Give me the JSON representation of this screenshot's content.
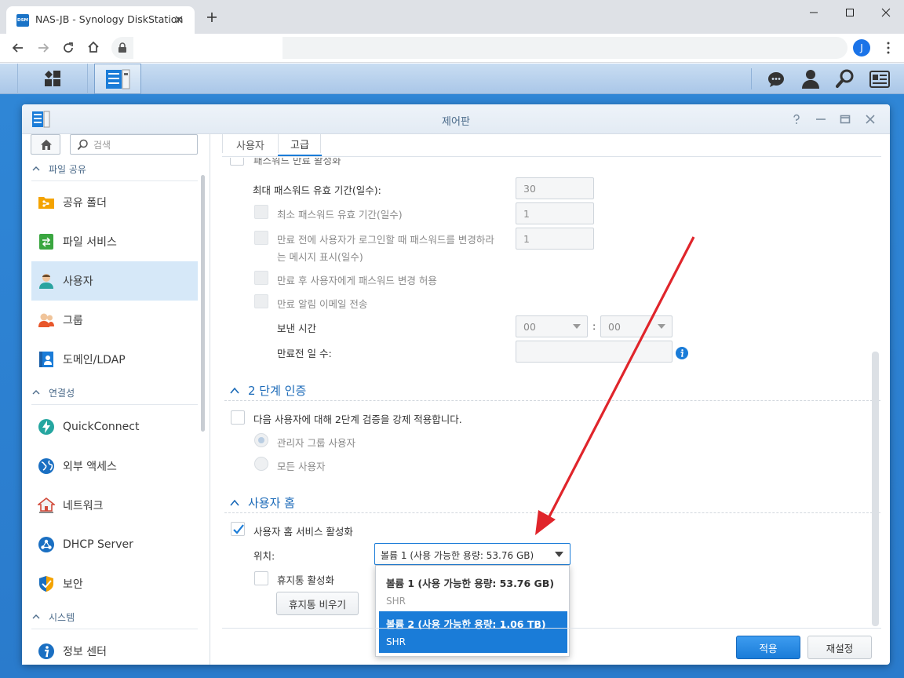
{
  "browser": {
    "tab_title": "NAS-JB - Synology DiskStation",
    "favicon_text": "DSM",
    "avatar_letter": "J"
  },
  "window": {
    "title": "제어판"
  },
  "sidebar": {
    "search_placeholder": "검색",
    "sections": {
      "file_sharing": "파일 공유",
      "connectivity": "연결성",
      "system": "시스템"
    },
    "items": {
      "shared_folder": "공유 폴더",
      "file_services": "파일 서비스",
      "user": "사용자",
      "group": "그룹",
      "domain_ldap": "도메인/LDAP",
      "quickconnect": "QuickConnect",
      "external_access": "외부 액세스",
      "network": "네트워크",
      "dhcp_server": "DHCP Server",
      "security": "보안",
      "info_center": "정보 센터"
    }
  },
  "tabs": {
    "user": "사용자",
    "advanced": "고급"
  },
  "password_expiry": {
    "partial_label": "패스워드 만료 활성화",
    "max_age_label": "최대 패스워드 유효 기간(일수):",
    "max_age_value": "30",
    "min_age_label": "최소 패스워드 유효 기간(일수)",
    "min_age_value": "1",
    "notify_label_line1": "만료 전에 사용자가 로그인할 때 패스워드를 변경하라",
    "notify_label_line2": "는 메시지 표시(일수)",
    "notify_value": "1",
    "allow_after_expiry": "만료 후 사용자에게 패스워드 변경 허용",
    "email_notify": "만료 알림 이메일 전송",
    "send_time_label": "보낸 시간",
    "hour_value": "00",
    "minute_value": "00",
    "time_sep": ":",
    "days_before_label": "만료전 일 수:"
  },
  "two_step": {
    "title": "2 단계 인증",
    "enforce_label": "다음 사용자에 대해 2단계 검증을 강제 적용합니다.",
    "admin_group": "관리자 그룹 사용자",
    "all_users": "모든 사용자"
  },
  "user_home": {
    "title": "사용자 홈",
    "enable_label": "사용자 홈 서비스 활성화",
    "location_label": "위치:",
    "location_value": "볼륨 1 (사용 가능한 용량:  53.76 GB)",
    "recycle_label": "휴지통 활성화",
    "empty_recycle_button": "휴지통 비우기",
    "options": [
      {
        "label": "볼륨 1 (사용 가능한 용량: 53.76 GB)",
        "sub": "SHR"
      },
      {
        "label": "볼륨 2 (사용 가능한 용량: 1.06 TB)",
        "sub": "SHR"
      }
    ]
  },
  "footer": {
    "apply": "적용",
    "reset": "재설정"
  },
  "colors": {
    "accent": "#1a7cd8",
    "arrow": "#e0252b",
    "selected_option": "#1a7cd8"
  }
}
